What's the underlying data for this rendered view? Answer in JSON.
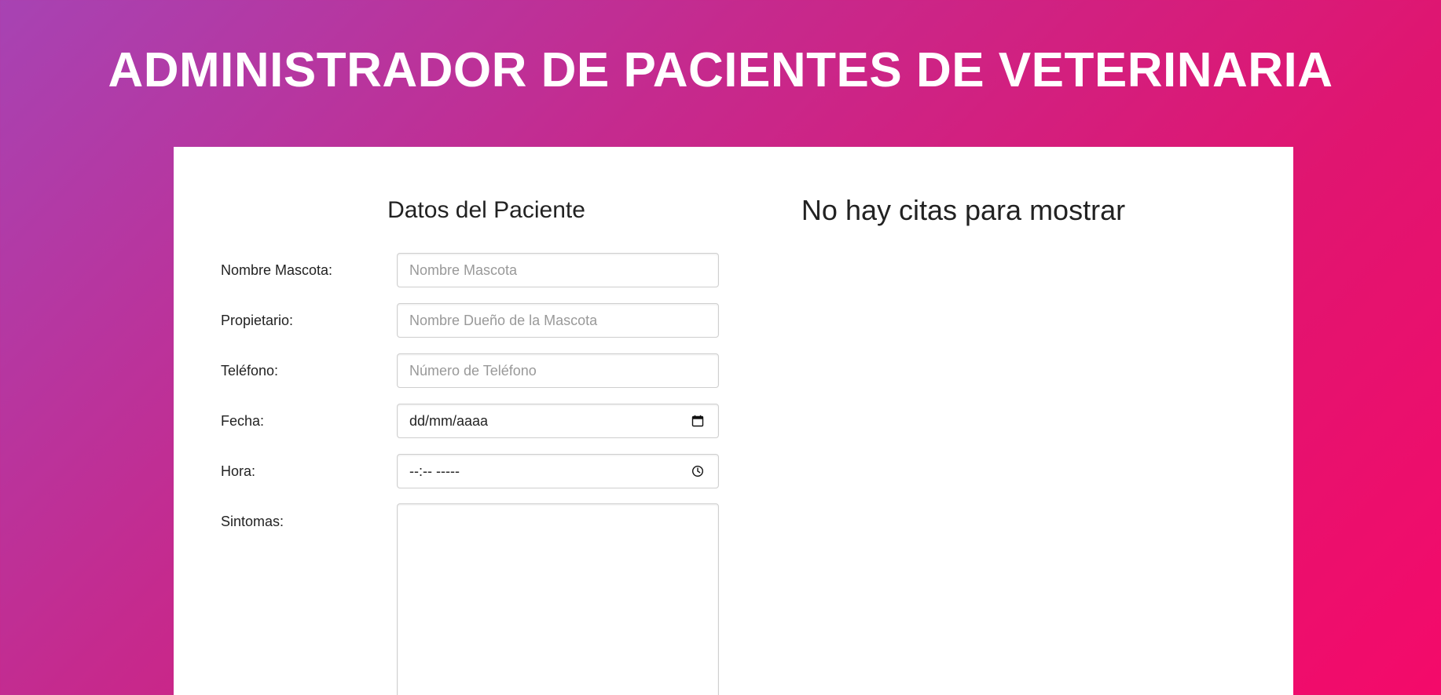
{
  "header": {
    "title": "ADMINISTRADOR DE PACIENTES DE VETERINARIA"
  },
  "form": {
    "title": "Datos del Paciente",
    "fields": [
      {
        "label": "Nombre Mascota:",
        "placeholder": "Nombre Mascota",
        "type": "text"
      },
      {
        "label": "Propietario:",
        "placeholder": "Nombre Dueño de la Mascota",
        "type": "text"
      },
      {
        "label": "Teléfono:",
        "placeholder": "Número de Teléfono",
        "type": "tel"
      },
      {
        "label": "Fecha:",
        "value": "dd/mm/aaaa",
        "type": "date",
        "icon": "calendar-icon"
      },
      {
        "label": "Hora:",
        "value": "--:-- -----",
        "type": "time",
        "icon": "clock-icon"
      },
      {
        "label": "Sintomas:",
        "value": "",
        "type": "textarea"
      }
    ]
  },
  "appointments": {
    "title": "No hay citas para mostrar"
  },
  "colors": {
    "gradient_start": "#a743b3",
    "gradient_end": "#f40a6a",
    "card_background": "#ffffff",
    "title_color": "#ffffff",
    "text_color": "#222222"
  }
}
